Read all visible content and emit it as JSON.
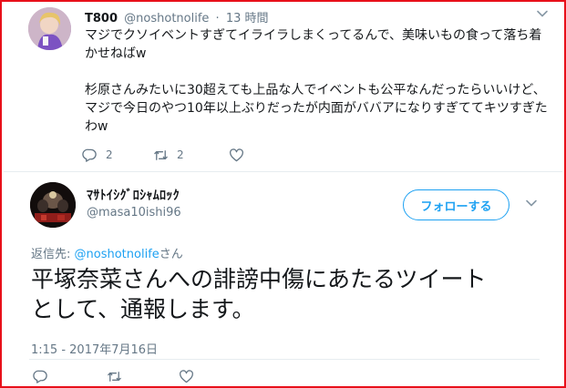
{
  "previous_tweet": {
    "display_name": "T800",
    "handle": "@noshotnolife",
    "separator": "·",
    "time": "13 時間",
    "text": "マジでクソイベントすぎてイライラしまくってるんで、美味いもの食って落ち着\nかせねばw\n\n杉原さんみたいに30超えても上品な人でイベントも公平なんだったらいいけど、\nマジで今日のやつ10年以上ぶりだったが内面がババアになりすぎててキツすぎた\nわw",
    "reply_count": "2",
    "retweet_count": "2",
    "icons": [
      "reply-icon",
      "retweet-icon",
      "like-icon",
      "chevron-down-icon"
    ]
  },
  "main_tweet": {
    "display_name": "ﾏｻﾄｲｼｸﾞﾛｼｬﾑﾛｯｸ",
    "handle": "@masa10ishi96",
    "follow_label": "フォローする",
    "reply_prefix": "返信先: ",
    "reply_mention": "@noshotnolife",
    "reply_suffix": "さん",
    "text": "平塚奈菜さんへの誹謗中傷にあたるツイート\nとして、通報します。",
    "timestamp": "1:15 - 2017年7月16日",
    "icons": [
      "reply-icon",
      "retweet-icon",
      "like-icon",
      "chevron-down-icon"
    ]
  },
  "colors": {
    "border": "#e8101a",
    "accent": "#1da1f2",
    "muted": "#657786",
    "text": "#14171a"
  }
}
